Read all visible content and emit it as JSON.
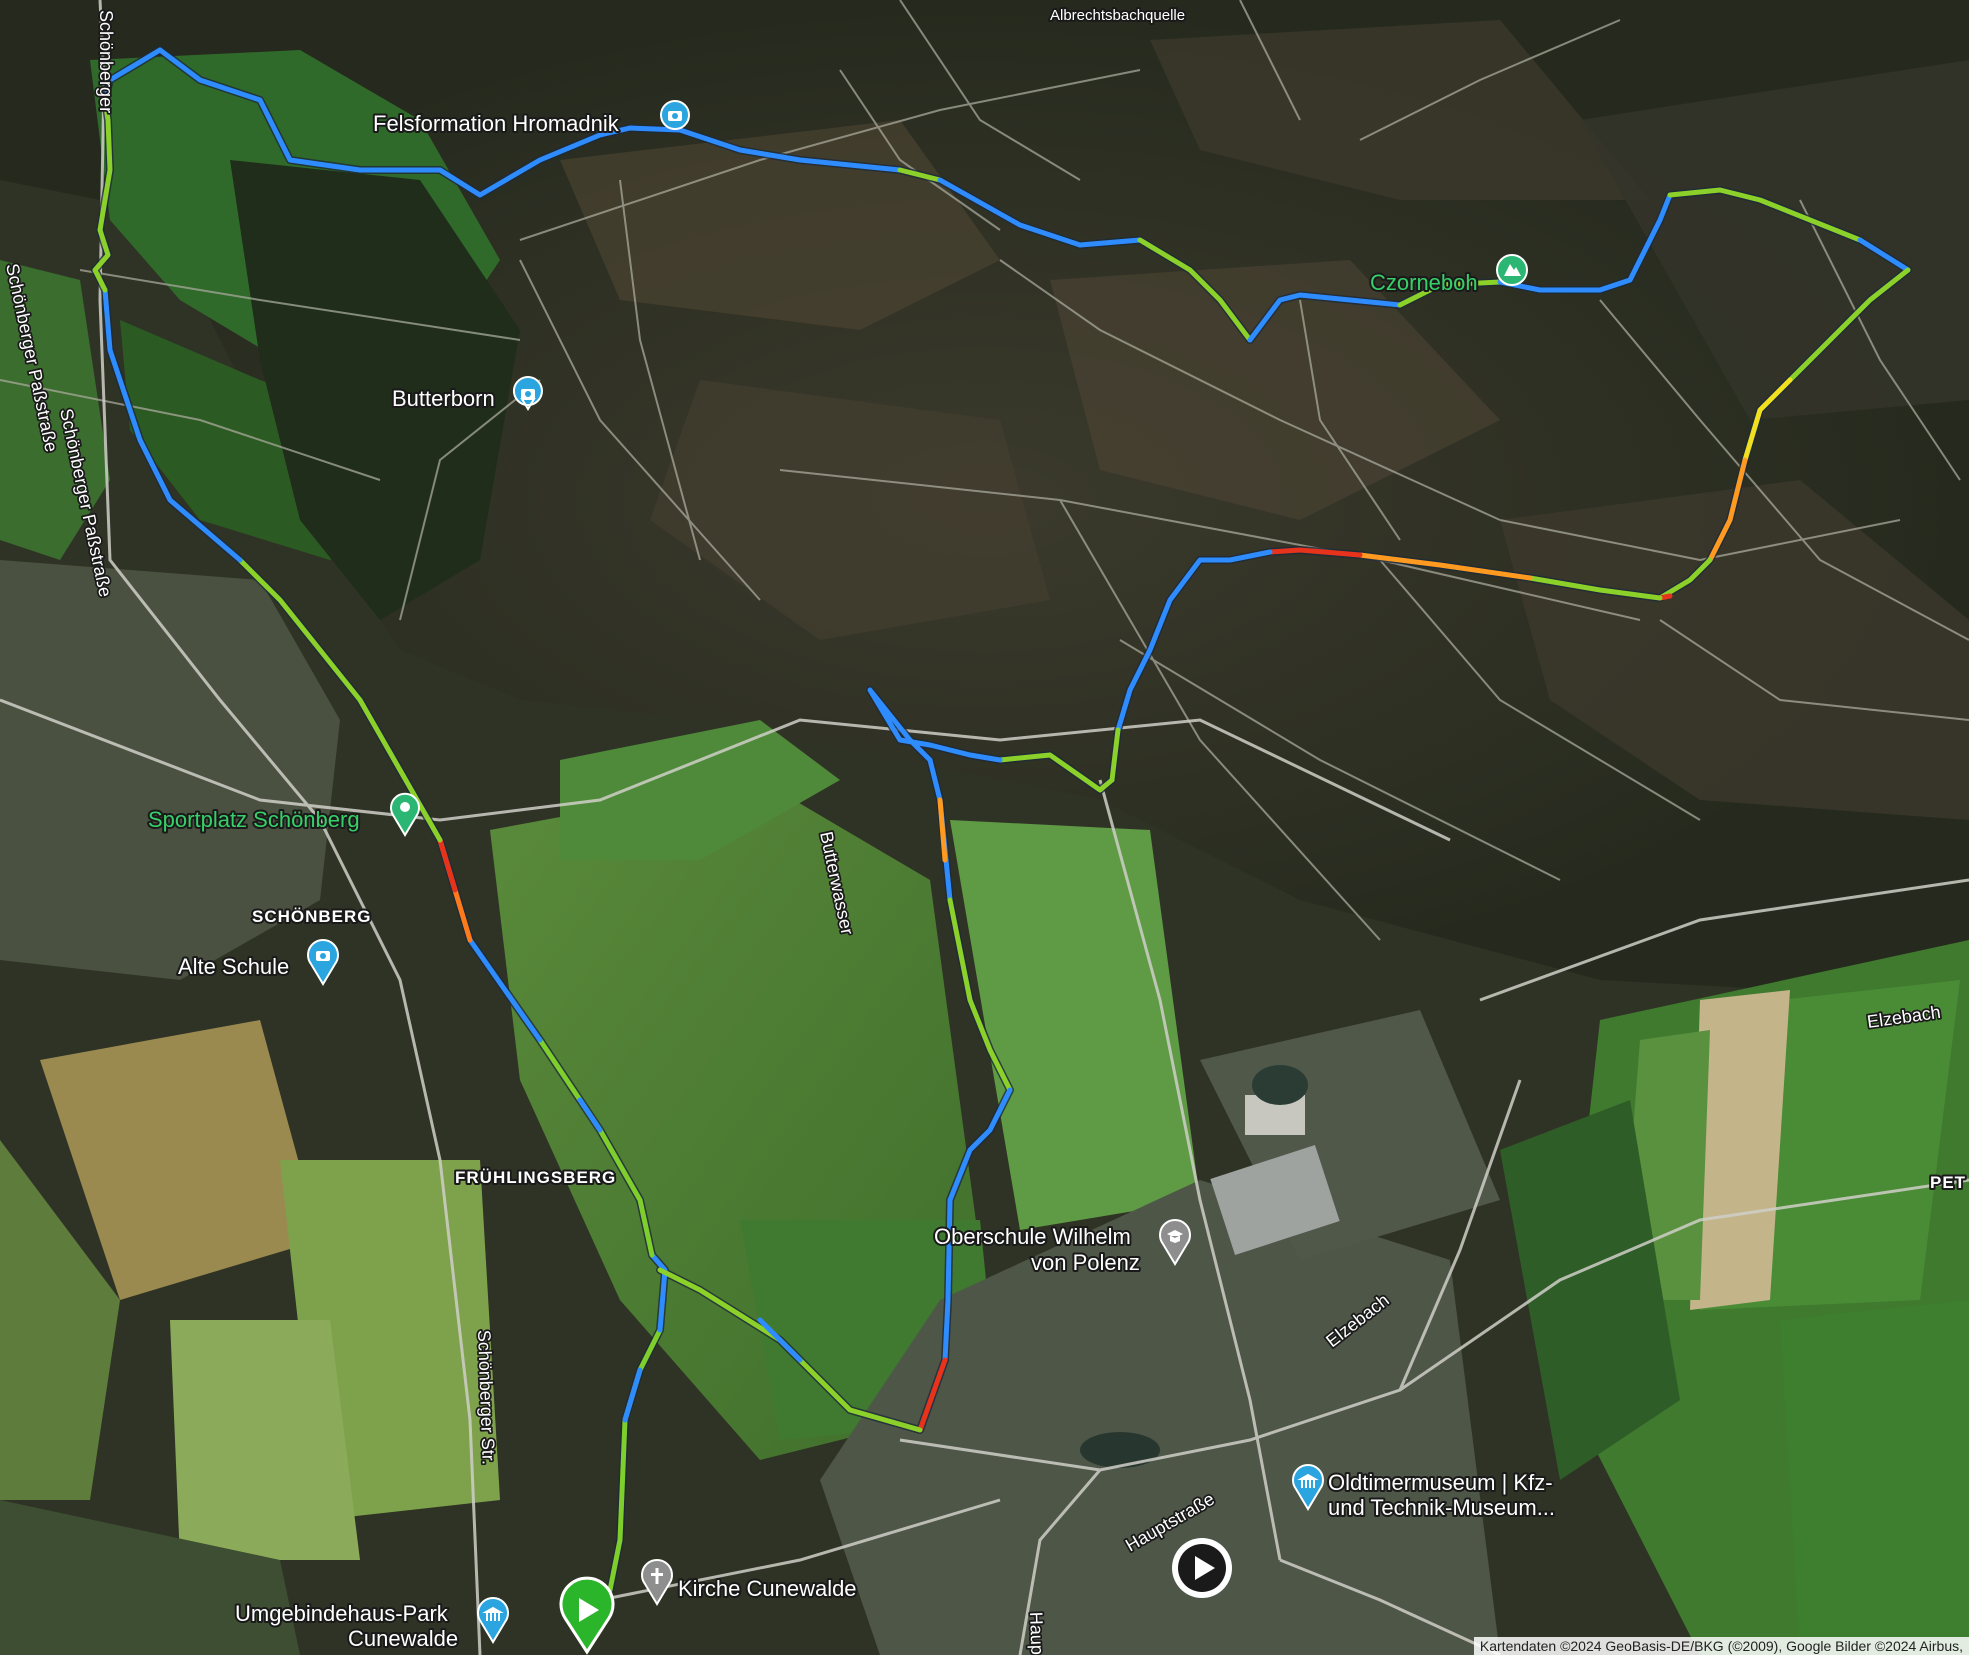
{
  "map": {
    "type": "satellite",
    "colors": {
      "route_slow": "#e8331c",
      "route_mid_orange": "#ff8c1a",
      "route_mid_yellow": "#f0e020",
      "route_mid_green": "#8bd12a",
      "route_fast": "#2f8cff",
      "start_marker": "#2bb52b",
      "poi_blue": "#2aa5e0",
      "poi_green": "#2bb673"
    }
  },
  "pois": {
    "albrechtsbachquelle": "Albrechtsbachquelle",
    "felsformation": "Felsformation Hromadnik",
    "czornebch": "Czorneboh",
    "butterborn": "Butterborn",
    "sportplatz": "Sportplatz Schönberg",
    "alte_schule": "Alte Schule",
    "oberschule_line1": "Oberschule Wilhelm",
    "oberschule_line2": "von Polenz",
    "kirche": "Kirche Cunewalde",
    "umgebindehaus_line1": "Umgebindehaus-Park",
    "umgebindehaus_line2": "Cunewalde",
    "oldtimer_line1": "Oldtimermuseum | Kfz-",
    "oldtimer_line2": "und Technik-Museum..."
  },
  "places": {
    "schoenberg": "SCHÖNBERG",
    "fruehlingsberg": "FRÜHLINGSBERG",
    "pet": "PET"
  },
  "streets": {
    "schoenberger_top": "Schönberger",
    "schoenberger_passstr_1": "Schönberger Paßstraße",
    "schoenberger_passstr_2": "Schönberger Paßstraße",
    "butterwasser": "Butterwasser",
    "schoenberger_str": "Schönberger Str.",
    "elzebach_1": "Elzebach",
    "elzebach_2": "Elzebach",
    "hauptstrasse": "Hauptstraße",
    "haup_partial": "Haup"
  },
  "attribution": "Kartendaten ©2024 GeoBasis-DE/BKG (©2009), Google Bilder ©2024 Airbus,"
}
